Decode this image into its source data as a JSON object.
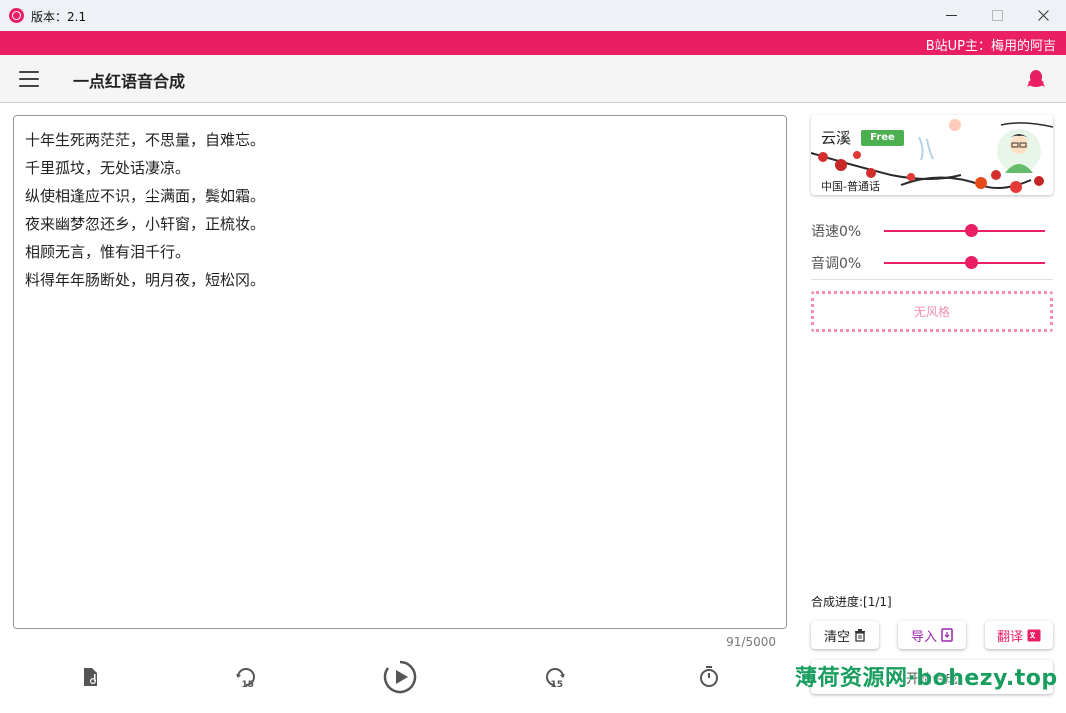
{
  "window": {
    "title": "版本：2.1",
    "minimize_icon": "minimize-icon",
    "maximize_icon": "maximize-icon",
    "close_icon": "close-icon"
  },
  "banner": {
    "text": "B站UP主：梅用的阿吉",
    "color": "#e91e63"
  },
  "appbar": {
    "title": "一点红语音合成",
    "menu_icon": "menu-icon",
    "qq_icon": "qq-icon"
  },
  "editor": {
    "lines": [
      "十年生死两茫茫，不思量，自难忘。",
      "千里孤坟，无处话凄凉。",
      "纵使相逢应不识，尘满面，鬓如霜。",
      "夜来幽梦忽还乡，小轩窗，正梳妆。",
      "相顾无言，惟有泪千行。",
      "料得年年肠断处，明月夜，短松冈。"
    ],
    "char_count": "91/5000"
  },
  "controls": {
    "export_icon": "audio-file-icon",
    "rewind_icon": "rewind-15-icon",
    "play_icon": "play-icon",
    "forward_icon": "forward-15-icon",
    "timer_icon": "timer-icon",
    "skip_seconds": "15"
  },
  "voice": {
    "name": "云溪",
    "badge": "Free",
    "region": "中国-普通话"
  },
  "sliders": {
    "speed_label": "语速0%",
    "pitch_label": "音调0%",
    "speed_value": 0.5,
    "pitch_value": 0.5
  },
  "style": {
    "label": "无风格"
  },
  "progress": {
    "label": "合成进度:[1/1]"
  },
  "actions": {
    "clear_label": "清空",
    "import_label": "导入",
    "translate_label": "翻译",
    "start_label": "开始合成"
  },
  "watermark": {
    "text": "薄荷资源网·bohezy.top"
  },
  "colors": {
    "accent": "#e91e63",
    "import_color": "#9c27b0",
    "translate_color": "#e91e63",
    "free_badge": "#4caf50"
  }
}
